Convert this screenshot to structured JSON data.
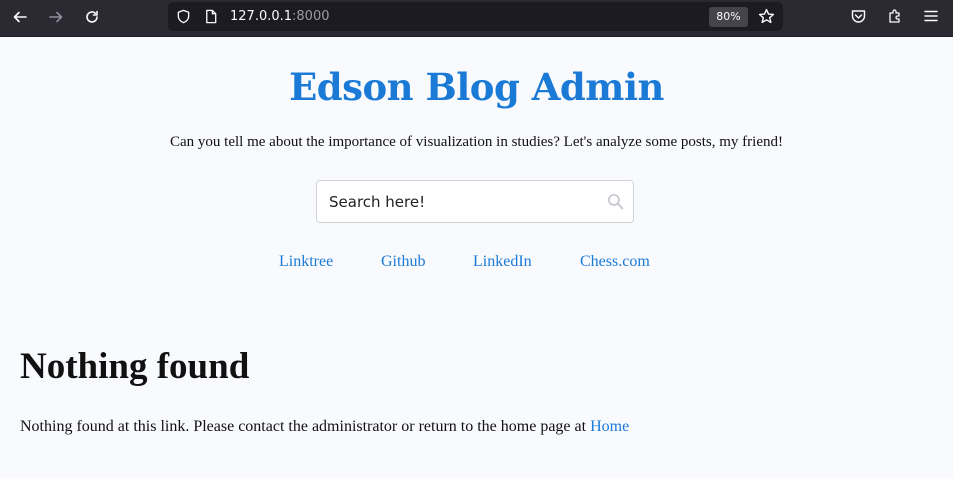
{
  "browser": {
    "url_host": "127.0.0.1",
    "url_port": ":8000",
    "zoom_level": "80%"
  },
  "site": {
    "title": "Edson Blog Admin",
    "tagline": "Can you tell me about the importance of visualization in studies? Let's analyze some posts, my friend!"
  },
  "search": {
    "placeholder": "Search here!"
  },
  "social_links": [
    {
      "label": "Linktree"
    },
    {
      "label": "Github"
    },
    {
      "label": "LinkedIn"
    },
    {
      "label": "Chess.com"
    }
  ],
  "not_found": {
    "heading": "Nothing found",
    "message": "Nothing found at this link. Please contact the administrator or return to the home page at",
    "home_link": "Home"
  }
}
